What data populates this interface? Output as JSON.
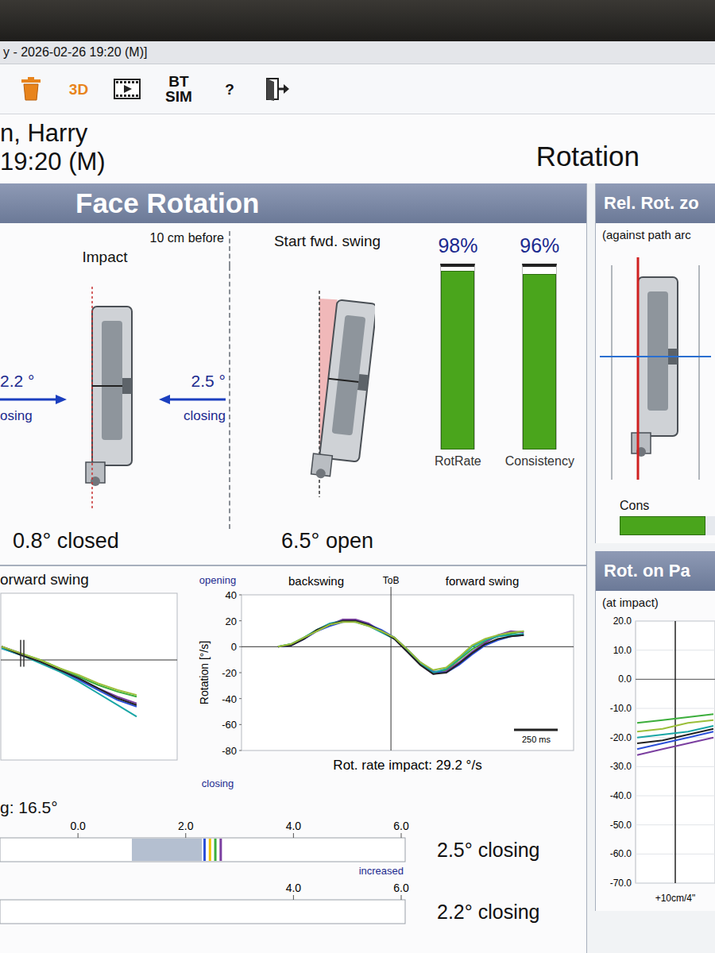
{
  "window": {
    "title": "y - 2026-02-26 19:20 (M)]"
  },
  "toolbar": [
    {
      "kind": "trash"
    },
    {
      "kind": "text",
      "label": "3D",
      "color": "#e8841c"
    },
    {
      "kind": "film"
    },
    {
      "kind": "text",
      "label": "BT SIM",
      "color": "#111111"
    },
    {
      "kind": "text",
      "label": "?",
      "color": "#111111"
    },
    {
      "kind": "exit"
    }
  ],
  "header": {
    "player": "n, Harry",
    "time": "19:20 (M)",
    "view": "Rotation"
  },
  "face_rotation": {
    "title": "Face Rotation",
    "impact": {
      "label": "Impact",
      "before_label": "10 cm before",
      "value": "0.8° closed",
      "impact_arrow": {
        "angle": "2.2 °",
        "direction": "osing"
      },
      "before_arrow": {
        "angle": "2.5 °",
        "direction": "closing"
      }
    },
    "start": {
      "label": "Start fwd. swing",
      "value": "6.5° open"
    },
    "bars": [
      {
        "label": "RotRate",
        "reading": "98%",
        "level": 0.98
      },
      {
        "label": "Consistency",
        "reading": "96%",
        "level": 0.96
      }
    ]
  },
  "forward_chart": {
    "title": "orward swing",
    "series": [
      {
        "color": "#3cae3c",
        "values": [
          8,
          4,
          0,
          -5,
          -10,
          -15,
          -19,
          -22
        ]
      },
      {
        "color": "#7b3fa0",
        "values": [
          8,
          4,
          -1,
          -6,
          -11,
          -17,
          -22,
          -26
        ]
      },
      {
        "color": "#2b4fd8",
        "values": [
          7,
          3,
          -1,
          -6,
          -12,
          -18,
          -24,
          -28
        ]
      },
      {
        "color": "#1aa6a6",
        "values": [
          7,
          3,
          -2,
          -7,
          -13,
          -20,
          -27,
          -34
        ]
      },
      {
        "color": "#222222",
        "values": [
          8,
          3,
          -1,
          -6,
          -11,
          -17,
          -23,
          -27
        ]
      },
      {
        "color": "#9bbf3a",
        "values": [
          8,
          4,
          0,
          -5,
          -9,
          -14,
          -18,
          -21
        ]
      }
    ]
  },
  "rotation_chart": {
    "opening": "opening",
    "closing": "closing",
    "backswing": "backswing",
    "forward": "forward swing",
    "top": "ToB",
    "y_label": "Rotation [°/s]",
    "y_ticks": [
      "40",
      "20",
      "0",
      "-20",
      "-40",
      "-60",
      "-80"
    ],
    "time_scale": "250 ms",
    "footer": "Rot. rate impact: 29.2 °/s",
    "series": [
      {
        "color": "#3cae3c",
        "values": [
          0,
          2,
          7,
          13,
          17,
          20,
          20,
          17,
          12,
          7,
          -3,
          -13,
          -20,
          -18,
          -10,
          -2,
          4,
          8,
          10,
          12
        ]
      },
      {
        "color": "#7b3fa0",
        "values": [
          0,
          1,
          6,
          12,
          17,
          21,
          21,
          18,
          12,
          6,
          -4,
          -14,
          -21,
          -19,
          -12,
          -4,
          3,
          9,
          12,
          11
        ]
      },
      {
        "color": "#2b4fd8",
        "values": [
          0,
          1,
          6,
          12,
          16,
          19,
          20,
          17,
          13,
          7,
          -2,
          -12,
          -19,
          -20,
          -14,
          -6,
          1,
          5,
          8,
          9
        ]
      },
      {
        "color": "#1aa6a6",
        "values": [
          0,
          2,
          7,
          13,
          18,
          20,
          19,
          16,
          11,
          6,
          -3,
          -13,
          -20,
          -17,
          -9,
          0,
          5,
          8,
          9,
          10
        ]
      },
      {
        "color": "#222222",
        "values": [
          0,
          1,
          6,
          13,
          17,
          20,
          20,
          17,
          12,
          6,
          -4,
          -14,
          -21,
          -20,
          -13,
          -5,
          2,
          6,
          8,
          9
        ]
      },
      {
        "color": "#9bbf3a",
        "values": [
          0,
          2,
          7,
          12,
          17,
          19,
          19,
          16,
          12,
          7,
          -2,
          -12,
          -18,
          -16,
          -8,
          1,
          6,
          9,
          11,
          12
        ]
      }
    ]
  },
  "timing": {
    "label": "g: 16.5°"
  },
  "scales": [
    {
      "ticks": [
        "0.0",
        "2.0",
        "4.0",
        "6.0"
      ],
      "note": "increased",
      "reading": "2.5° closing",
      "range": [
        1.0,
        2.3
      ],
      "markers": [
        {
          "value": 2.35,
          "color": "#2b4fd8"
        },
        {
          "value": 2.45,
          "color": "#f2c200"
        },
        {
          "value": 2.55,
          "color": "#3cae3c"
        },
        {
          "value": 2.65,
          "color": "#7b3fa0"
        }
      ]
    },
    {
      "ticks": [
        "4.0",
        "6.0"
      ],
      "reading": "2.2° closing",
      "markers": []
    }
  ],
  "rel_rot": {
    "title": "Rel. Rot. zo",
    "subtitle": "(against path arc",
    "cons_label": "Cons",
    "cons_level": 0.9
  },
  "rot_on_path": {
    "title": "Rot. on Pa",
    "subtitle": "(at impact)",
    "y_ticks": [
      "20.0",
      "10.0",
      "0.0",
      "-10.0",
      "-20.0",
      "-30.0",
      "-40.0",
      "-50.0",
      "-60.0",
      "-70.0"
    ],
    "x_label": "+10cm/4\"",
    "series": [
      {
        "color": "#3cae3c",
        "values": [
          -15,
          -14,
          -13,
          -12
        ]
      },
      {
        "color": "#9bbf3a",
        "values": [
          -18,
          -17,
          -15,
          -14
        ]
      },
      {
        "color": "#1aa6a6",
        "values": [
          -20,
          -19,
          -18,
          -16
        ]
      },
      {
        "color": "#2b4fd8",
        "values": [
          -24,
          -22,
          -20,
          -18
        ]
      },
      {
        "color": "#7b3fa0",
        "values": [
          -26,
          -24,
          -22,
          -20
        ]
      },
      {
        "color": "#222222",
        "values": [
          -22,
          -21,
          -19,
          -17
        ]
      }
    ]
  }
}
